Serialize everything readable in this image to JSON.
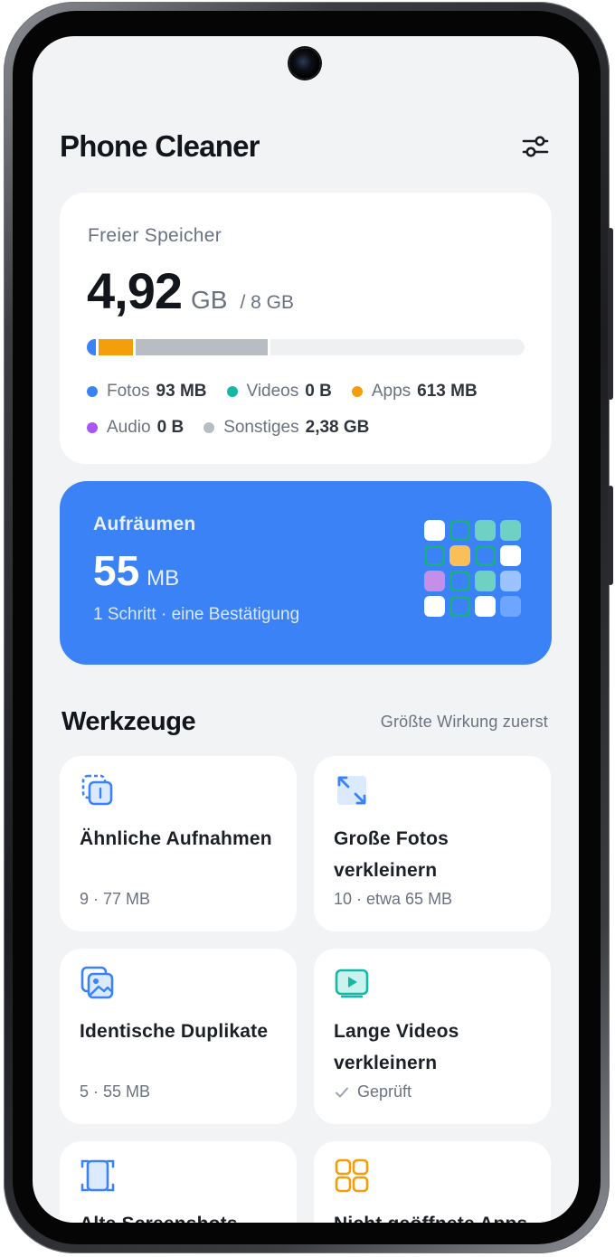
{
  "app": {
    "title": "Phone Cleaner"
  },
  "storage": {
    "label": "Freier Speicher",
    "free_value": "4,92",
    "free_unit": "GB",
    "total": "/ 8 GB",
    "usage_fraction": {
      "photos": 0.02,
      "apps": 0.08,
      "other": 0.3
    },
    "legend": [
      {
        "name": "Fotos",
        "value": "93 MB",
        "color": "#3b82f6"
      },
      {
        "name": "Videos",
        "value": "0 B",
        "color": "#14b8a6"
      },
      {
        "name": "Apps",
        "value": "613 MB",
        "color": "#f59e0b"
      },
      {
        "name": "Audio",
        "value": "0 B",
        "color": "#a855f7"
      },
      {
        "name": "Sonstiges",
        "value": "2,38 GB",
        "color": "#b8bdc4"
      }
    ]
  },
  "cleanup": {
    "title": "Aufräumen",
    "amount": "55",
    "unit": "MB",
    "subtitle": "1 Schritt · eine Bestätigung",
    "accent": "#3b82f6"
  },
  "tools_section": {
    "heading": "Werkzeuge",
    "hint": "Größte Wirkung zuerst"
  },
  "tools": [
    {
      "name": "Ähnliche Aufnahmen",
      "meta": "9 · 77 MB",
      "icon": "similar-photos-icon"
    },
    {
      "name": "Große Fotos verkleinern",
      "meta": "10 · etwa 65 MB",
      "icon": "resize-icon"
    },
    {
      "name": "Identische Duplikate",
      "meta": "5 · 55 MB",
      "icon": "duplicate-images-icon"
    },
    {
      "name": "Lange Videos verkleinern",
      "meta": "Geprüft",
      "icon": "video-icon"
    },
    {
      "name": "Alte Screenshots",
      "meta": "",
      "icon": "screenshot-icon"
    },
    {
      "name": "Nicht geöffnete Apps",
      "meta": "",
      "icon": "apps-grid-icon"
    }
  ]
}
